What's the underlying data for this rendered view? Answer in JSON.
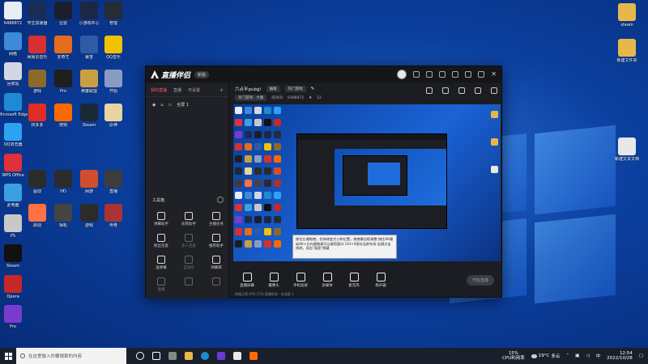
{
  "desktop": {
    "left_icons": [
      {
        "label": "6488872",
        "color": "#e8eef6"
      },
      {
        "label": "网络",
        "color": "#3d8bd8"
      },
      {
        "label": "回收站",
        "color": "#d0d8e4"
      },
      {
        "label": "Microsoft Edge",
        "color": "#1f8ad4"
      },
      {
        "label": "QQ浏览器",
        "color": "#2ba3f0"
      },
      {
        "label": "WPS Office",
        "color": "#e0303b"
      },
      {
        "label": "此电脑",
        "color": "#3aa0e0"
      },
      {
        "label": "PS",
        "color": "#c8c8c8"
      },
      {
        "label": "Steam",
        "color": "#111"
      },
      {
        "label": "Opera",
        "color": "#c62828"
      },
      {
        "label": "Pro",
        "color": "#7a3bd1"
      }
    ],
    "grid_icons": [
      {
        "label": "学生加速器",
        "color": "#1a2c55"
      },
      {
        "label": "迅雷",
        "color": "#1b1f2a"
      },
      {
        "label": "小游戏中心",
        "color": "#1d2744"
      },
      {
        "label": "管理",
        "color": "#262b36"
      },
      {
        "label": "网易云音乐",
        "color": "#d63031"
      },
      {
        "label": "爱奇艺",
        "color": "#e46d1b"
      },
      {
        "label": "暴雪",
        "color": "#2d5ba8"
      },
      {
        "label": "QQ音乐",
        "color": "#f2c200"
      },
      {
        "label": "游戏",
        "color": "#8b6a2a"
      },
      {
        "label": "Pro",
        "color": "#1e1e1e"
      },
      {
        "label": "英雄联盟",
        "color": "#c8a043"
      },
      {
        "label": "开始",
        "color": "#8a9cc4"
      },
      {
        "label": "拼多多",
        "color": "#e02e24"
      },
      {
        "label": "搜狗",
        "color": "#ff6a00"
      },
      {
        "label": "Steam",
        "color": "#1b2838"
      },
      {
        "label": "原神",
        "color": "#e8d4a0"
      },
      {
        "label": "驱动",
        "color": "#2b2b2b"
      },
      {
        "label": "HD",
        "color": "#2b2b2b"
      },
      {
        "label": "网游",
        "color": "#d34d2d"
      },
      {
        "label": "直播",
        "color": "#3c3c3c"
      },
      {
        "label": "启动",
        "color": "#ff7043"
      },
      {
        "label": "相机",
        "color": "#444"
      },
      {
        "label": "游戏",
        "color": "#2b2b2b"
      },
      {
        "label": "传奇",
        "color": "#a33"
      }
    ],
    "right_icons": [
      {
        "label": "steam",
        "color": "#e6b84c"
      },
      {
        "label": "新建文件夹",
        "color": "#e6b84c"
      },
      {
        "label": "新建文本文档",
        "color": "#e8e8e8"
      }
    ]
  },
  "app": {
    "name": "直播伴侣",
    "version": "新版",
    "tabs": [
      "我的直播",
      "直播",
      "可设置"
    ],
    "scene_label": "全屏 1",
    "tools_header": "工具箱",
    "tools": [
      {
        "label": "弹幕助手"
      },
      {
        "label": "房管助手"
      },
      {
        "label": "主播任务"
      },
      {
        "label": "粉丝连麦"
      },
      {
        "label": "多人连麦",
        "dim": true
      },
      {
        "label": "推荐助手"
      },
      {
        "label": "送弹幕"
      },
      {
        "label": "自动答",
        "dim": true
      },
      {
        "label": "弹幕库"
      },
      {
        "label": "直播",
        "dim": true
      },
      {
        "label": "",
        "dim": true
      },
      {
        "label": "",
        "dim": true
      }
    ],
    "room_title": "六点半pubg!",
    "room_chip": "编辑",
    "category_chip": "热门游戏",
    "tag_chip": "热门游戏 · 大咖",
    "room_id_label": "房间ID",
    "room_id": "6488872",
    "fans": "12",
    "controls": [
      {
        "label": "直播屏幕"
      },
      {
        "label": "摄像头"
      },
      {
        "label": "手机投屏"
      },
      {
        "label": "多媒体"
      },
      {
        "label": "麦克风"
      },
      {
        "label": "扬声器"
      }
    ],
    "go_live": "开始直播",
    "status_text": "网络正常  CPU 15%  直播状态 · 未连接 1",
    "tooltip": "按住左键拖拽，拉伸改变大小和位置，拖拽最边框调整 按住Alt键或Alt+方向键微调可以裁剪窗口 Ctrl+S保存当前布局 右键点击修改，双击\"画面\"隐藏"
  },
  "taskbar": {
    "search_placeholder": "在这里输入你要搜索的内容",
    "cpu_label": "CPU利用率",
    "cpu_value": "15%",
    "temperature": "19°C",
    "weather": "多云",
    "time": "12:54",
    "date": "2022/10/28",
    "lang": "中"
  }
}
